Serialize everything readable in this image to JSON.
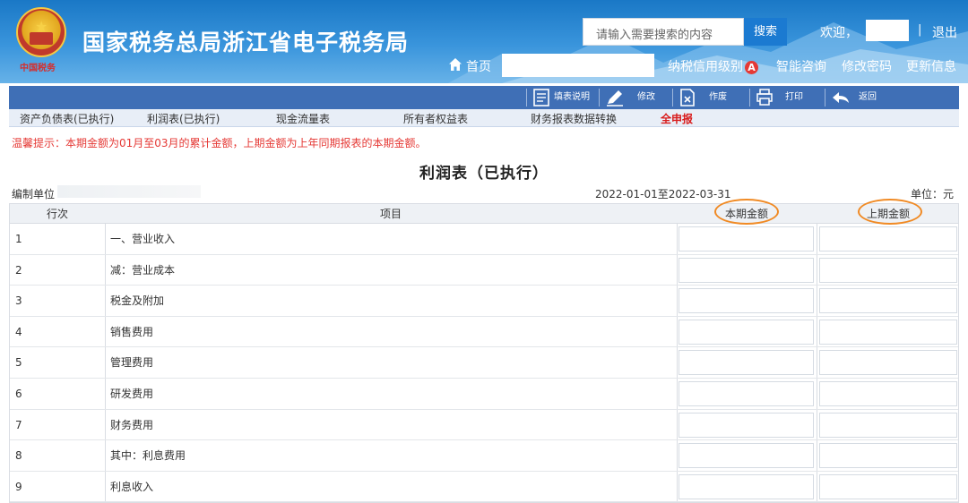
{
  "header": {
    "site_title": "国家税务总局浙江省电子税务局",
    "emblem_caption": "中国税务",
    "search_placeholder": "请输入需要搜索的内容",
    "search_label": "搜索",
    "welcome": "欢迎，",
    "separator": "|",
    "logout": "退出",
    "home": "首页",
    "credit_level": "纳税信用级别",
    "credit_grade": "A",
    "smart_consult": "智能咨询",
    "change_password": "修改密码",
    "update_info": "更新信息"
  },
  "toolbar": {
    "fill_guide": "填表说明",
    "edit": "修改",
    "void": "作废",
    "print": "打印",
    "back": "返回"
  },
  "tabs": [
    "资产负债表(已执行)",
    "利润表(已执行)",
    "现金流量表",
    "所有者权益表",
    "财务报表数据转换",
    "全申报"
  ],
  "tip": "温馨提示：本期金额为01月至03月的累计金额，上期金额为上年同期报表的本期金额。",
  "report": {
    "title": "利润表（已执行）",
    "compiler_label": "编制单位",
    "period": "2022-01-01至2022-03-31",
    "unit": "单位：元"
  },
  "table": {
    "headers": {
      "row_no": "行次",
      "item": "项目",
      "current": "本期金额",
      "previous": "上期金额"
    },
    "rows": [
      {
        "no": "1",
        "item": "一、营业收入"
      },
      {
        "no": "2",
        "item": "减：营业成本"
      },
      {
        "no": "3",
        "item": "税金及附加"
      },
      {
        "no": "4",
        "item": "销售费用"
      },
      {
        "no": "5",
        "item": "管理费用"
      },
      {
        "no": "6",
        "item": "研发费用"
      },
      {
        "no": "7",
        "item": "财务费用"
      },
      {
        "no": "8",
        "item": "其中：利息费用"
      },
      {
        "no": "9",
        "item": "利息收入"
      }
    ]
  },
  "colors": {
    "header_blue": "#2a86d2",
    "toolbar_blue": "#3f6fb6",
    "tip_red": "#e53935",
    "highlight_orange": "#f08a24"
  }
}
